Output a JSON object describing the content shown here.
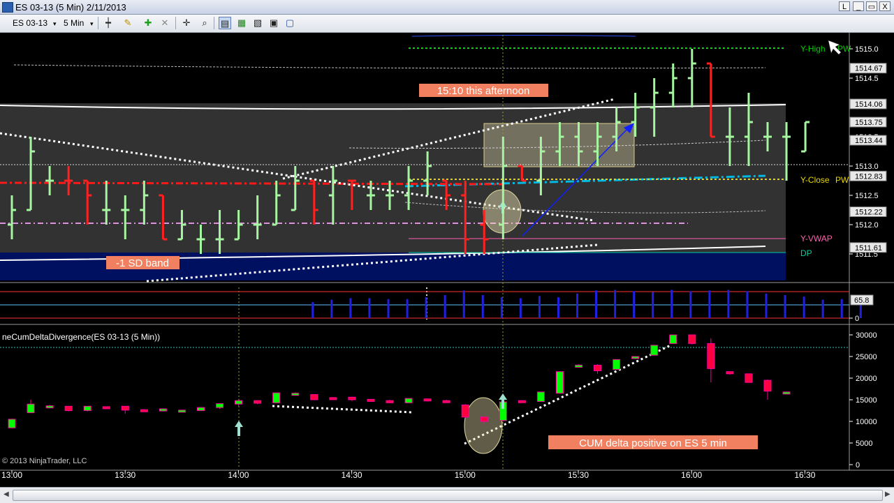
{
  "window": {
    "title": "ES 03-13 (5 Min)  2/11/2013",
    "buttons": [
      "L",
      "_",
      "▭",
      "X"
    ]
  },
  "toolbar": {
    "instrument": "ES 03-13",
    "interval": "5 Min",
    "icons": [
      "bar-type-icon",
      "drawing-pencil-icon",
      "add-indicator-icon",
      "remove-indicator-icon",
      "crosshair-icon",
      "zoom-icon",
      "chart-trader-icon",
      "data-box-icon",
      "properties-icon",
      "alert-icon",
      "window-icon"
    ]
  },
  "colors": {
    "up_bar": "#a6f5a0",
    "down_bar": "#ff2020",
    "prior_high": "#00e000",
    "prior_close": "#e8d800",
    "vwap": "#ff60b0",
    "dp": "#00d0a0",
    "volume": "#2020e0",
    "delta_up": "#00ff00",
    "delta_down": "#ff0040"
  },
  "chart_data": [
    {
      "type": "bar",
      "panel": "price",
      "right_labels": [
        {
          "text": "Y-High",
          "value": 1515.0
        },
        {
          "text": "PW",
          "value": 1515.0
        },
        {
          "text": "Y-Close",
          "value": 1512.86
        },
        {
          "text": "PW",
          "value": 1512.86
        },
        {
          "text": "Y-VWAP",
          "value": 1511.75
        },
        {
          "text": "DP",
          "value": 1511.5
        }
      ],
      "y_ticks": [
        1515.0,
        1514.5,
        1513.5,
        1513.0,
        1512.5,
        1512.0,
        1511.5
      ],
      "price_markers": [
        "1514.67",
        "1514.06",
        "1513.75",
        "1513.44",
        "1512.83",
        "1512.22",
        "1511.61"
      ],
      "ylim": [
        1511.3,
        1515.2
      ],
      "annotations": [
        "15:10 this afternoon",
        "-1 SD band"
      ],
      "x_ticks": [
        "13:00",
        "13:30",
        "14:00",
        "14:30",
        "15:00",
        "15:30",
        "16:00",
        "16:30"
      ],
      "bars": [
        {
          "t": "12:59",
          "o": 1512.0,
          "h": 1512.5,
          "l": 1511.75,
          "c": 1512.25,
          "up": true
        },
        {
          "t": "13:04",
          "o": 1512.25,
          "h": 1513.5,
          "l": 1512.25,
          "c": 1513.25,
          "up": true
        },
        {
          "t": "13:09",
          "o": 1512.75,
          "h": 1513.0,
          "l": 1512.5,
          "c": 1512.75,
          "up": true
        },
        {
          "t": "13:14",
          "o": 1512.75,
          "h": 1513.0,
          "l": 1512.5,
          "c": 1512.75,
          "up": false
        },
        {
          "t": "13:19",
          "o": 1512.75,
          "h": 1512.75,
          "l": 1512.0,
          "c": 1512.5,
          "up": false
        },
        {
          "t": "13:24",
          "o": 1512.25,
          "h": 1512.75,
          "l": 1512.0,
          "c": 1512.25,
          "up": true
        },
        {
          "t": "13:29",
          "o": 1512.25,
          "h": 1512.5,
          "l": 1511.75,
          "c": 1512.25,
          "up": true
        },
        {
          "t": "13:34",
          "o": 1512.25,
          "h": 1512.75,
          "l": 1512.0,
          "c": 1512.5,
          "up": true
        },
        {
          "t": "13:39",
          "o": 1512.5,
          "h": 1512.5,
          "l": 1511.75,
          "c": 1511.75,
          "up": false
        },
        {
          "t": "13:44",
          "o": 1511.75,
          "h": 1512.25,
          "l": 1511.75,
          "c": 1512.0,
          "up": true
        },
        {
          "t": "13:49",
          "o": 1511.75,
          "h": 1512.0,
          "l": 1511.5,
          "c": 1511.75,
          "up": true
        },
        {
          "t": "13:54",
          "o": 1511.75,
          "h": 1512.25,
          "l": 1511.5,
          "c": 1511.75,
          "up": true
        },
        {
          "t": "13:59",
          "o": 1511.75,
          "h": 1512.25,
          "l": 1511.75,
          "c": 1512.0,
          "up": true
        },
        {
          "t": "14:04",
          "o": 1512.0,
          "h": 1512.5,
          "l": 1511.75,
          "c": 1512.0,
          "up": true
        },
        {
          "t": "14:09",
          "o": 1512.0,
          "h": 1512.75,
          "l": 1512.0,
          "c": 1512.5,
          "up": true
        },
        {
          "t": "14:14",
          "o": 1512.25,
          "h": 1513.0,
          "l": 1512.25,
          "c": 1512.75,
          "up": true
        },
        {
          "t": "14:19",
          "o": 1512.75,
          "h": 1512.75,
          "l": 1512.0,
          "c": 1512.25,
          "up": false
        },
        {
          "t": "14:24",
          "o": 1512.5,
          "h": 1513.0,
          "l": 1512.0,
          "c": 1512.75,
          "up": true
        },
        {
          "t": "14:29",
          "o": 1512.75,
          "h": 1512.75,
          "l": 1512.25,
          "c": 1512.75,
          "up": false
        },
        {
          "t": "14:34",
          "o": 1512.5,
          "h": 1512.75,
          "l": 1512.25,
          "c": 1512.5,
          "up": true
        },
        {
          "t": "14:39",
          "o": 1512.5,
          "h": 1512.75,
          "l": 1512.25,
          "c": 1512.5,
          "up": true
        },
        {
          "t": "14:44",
          "o": 1512.5,
          "h": 1513.0,
          "l": 1512.25,
          "c": 1512.75,
          "up": true
        },
        {
          "t": "14:49",
          "o": 1512.75,
          "h": 1513.25,
          "l": 1512.5,
          "c": 1513.0,
          "up": true
        },
        {
          "t": "14:54",
          "o": 1512.75,
          "h": 1512.75,
          "l": 1512.25,
          "c": 1512.5,
          "up": false
        },
        {
          "t": "14:59",
          "o": 1512.5,
          "h": 1512.75,
          "l": 1511.5,
          "c": 1511.75,
          "up": false
        },
        {
          "t": "15:04",
          "o": 1512.0,
          "h": 1512.25,
          "l": 1511.5,
          "c": 1511.75,
          "up": false
        },
        {
          "t": "15:09",
          "o": 1512.0,
          "h": 1513.5,
          "l": 1511.75,
          "c": 1513.0,
          "up": true
        },
        {
          "t": "15:14",
          "o": 1513.0,
          "h": 1513.0,
          "l": 1512.75,
          "c": 1512.75,
          "up": false
        },
        {
          "t": "15:19",
          "o": 1512.75,
          "h": 1513.5,
          "l": 1512.5,
          "c": 1513.25,
          "up": true
        },
        {
          "t": "15:24",
          "o": 1513.25,
          "h": 1513.75,
          "l": 1513.0,
          "c": 1513.5,
          "up": true
        },
        {
          "t": "15:29",
          "o": 1513.5,
          "h": 1513.75,
          "l": 1513.0,
          "c": 1513.25,
          "up": true
        },
        {
          "t": "15:34",
          "o": 1513.25,
          "h": 1513.75,
          "l": 1513.0,
          "c": 1513.5,
          "up": true
        },
        {
          "t": "15:39",
          "o": 1513.5,
          "h": 1514.0,
          "l": 1513.25,
          "c": 1513.75,
          "up": true
        },
        {
          "t": "15:44",
          "o": 1513.75,
          "h": 1514.25,
          "l": 1513.5,
          "c": 1514.0,
          "up": true
        },
        {
          "t": "15:49",
          "o": 1514.0,
          "h": 1514.5,
          "l": 1513.5,
          "c": 1514.25,
          "up": true
        },
        {
          "t": "15:54",
          "o": 1514.25,
          "h": 1514.75,
          "l": 1514.0,
          "c": 1514.5,
          "up": true
        },
        {
          "t": "15:59",
          "o": 1514.5,
          "h": 1515.0,
          "l": 1514.0,
          "c": 1514.75,
          "up": true
        },
        {
          "t": "16:04",
          "o": 1514.75,
          "h": 1514.75,
          "l": 1513.5,
          "c": 1513.5,
          "up": false
        },
        {
          "t": "16:09",
          "o": 1513.5,
          "h": 1514.0,
          "l": 1513.0,
          "c": 1513.5,
          "up": true
        },
        {
          "t": "16:14",
          "o": 1513.5,
          "h": 1514.25,
          "l": 1513.0,
          "c": 1513.75,
          "up": true
        },
        {
          "t": "16:19",
          "o": 1513.5,
          "h": 1513.75,
          "l": 1513.25,
          "c": 1513.5,
          "up": true
        },
        {
          "t": "16:24",
          "o": 1513.5,
          "h": 1513.75,
          "l": 1512.75,
          "c": 1513.5,
          "up": true
        },
        {
          "t": "16:29",
          "o": 1513.25,
          "h": 1513.75,
          "l": 1513.25,
          "c": 1513.75,
          "up": true
        }
      ]
    },
    {
      "type": "bar",
      "panel": "volume",
      "marker": "65.8",
      "y_ticks": [
        0
      ],
      "ylim": [
        0,
        100
      ],
      "values": [
        0,
        0,
        0,
        0,
        0,
        0,
        0,
        0,
        0,
        0,
        0,
        0,
        0,
        0,
        0,
        0,
        52,
        60,
        65,
        65,
        62,
        62,
        68,
        75,
        90,
        75,
        68,
        65,
        72,
        68,
        80,
        90,
        92,
        88,
        85,
        92,
        88,
        90,
        92,
        88,
        80,
        75,
        70,
        60,
        62,
        72
      ]
    },
    {
      "type": "bar",
      "panel": "indicator",
      "title": "neCumDeltaDivergence(ES 03-13 (5 Min))",
      "annotations": [
        "CUM delta positive on ES 5 min"
      ],
      "y_ticks": [
        30000,
        25000,
        20000,
        15000,
        10000,
        5000,
        0
      ],
      "ylim": [
        0,
        32000
      ],
      "candles": [
        {
          "o": 8500,
          "c": 10500,
          "h": 10500,
          "l": 8500
        },
        {
          "o": 12000,
          "c": 14000,
          "h": 15000,
          "l": 12000
        },
        {
          "o": 13200,
          "c": 13600,
          "h": 13800,
          "l": 13000
        },
        {
          "o": 13500,
          "c": 12500,
          "h": 13500,
          "l": 12300
        },
        {
          "o": 12500,
          "c": 13500,
          "h": 13500,
          "l": 12300
        },
        {
          "o": 13400,
          "c": 13100,
          "h": 13400,
          "l": 13000
        },
        {
          "o": 13500,
          "c": 12600,
          "h": 13500,
          "l": 11800
        },
        {
          "o": 12700,
          "c": 12400,
          "h": 12800,
          "l": 12200
        },
        {
          "o": 12400,
          "c": 12900,
          "h": 13000,
          "l": 12300
        },
        {
          "o": 12300,
          "c": 12600,
          "h": 12700,
          "l": 12200
        },
        {
          "o": 12500,
          "c": 13200,
          "h": 13200,
          "l": 12400
        },
        {
          "o": 13200,
          "c": 14100,
          "h": 14100,
          "l": 12900
        },
        {
          "o": 14000,
          "c": 14800,
          "h": 15200,
          "l": 13500
        },
        {
          "o": 14800,
          "c": 14200,
          "h": 14800,
          "l": 14000
        },
        {
          "o": 14300,
          "c": 16600,
          "h": 16600,
          "l": 14300
        },
        {
          "o": 16500,
          "c": 16500,
          "h": 16700,
          "l": 16300
        },
        {
          "o": 16200,
          "c": 15000,
          "h": 16200,
          "l": 15000
        },
        {
          "o": 15500,
          "c": 15200,
          "h": 15600,
          "l": 15000
        },
        {
          "o": 15600,
          "c": 15000,
          "h": 15600,
          "l": 14700
        },
        {
          "o": 15100,
          "c": 14900,
          "h": 15200,
          "l": 14600
        },
        {
          "o": 14800,
          "c": 14300,
          "h": 15000,
          "l": 14200
        },
        {
          "o": 14300,
          "c": 15300,
          "h": 15300,
          "l": 14200
        },
        {
          "o": 15200,
          "c": 14800,
          "h": 15300,
          "l": 14600
        },
        {
          "o": 14800,
          "c": 14500,
          "h": 15000,
          "l": 14300
        },
        {
          "o": 13800,
          "c": 11000,
          "h": 14000,
          "l": 10800
        },
        {
          "o": 11000,
          "c": 10000,
          "h": 11200,
          "l": 9200
        },
        {
          "o": 10200,
          "c": 14500,
          "h": 14500,
          "l": 10000
        },
        {
          "o": 14800,
          "c": 14600,
          "h": 14900,
          "l": 14500
        },
        {
          "o": 14600,
          "c": 16800,
          "h": 16800,
          "l": 14600
        },
        {
          "o": 16500,
          "c": 21500,
          "h": 21500,
          "l": 16500
        },
        {
          "o": 22700,
          "c": 23000,
          "h": 23200,
          "l": 22600
        },
        {
          "o": 23000,
          "c": 21700,
          "h": 23200,
          "l": 21000
        },
        {
          "o": 22000,
          "c": 24300,
          "h": 24300,
          "l": 22000
        },
        {
          "o": 24600,
          "c": 25000,
          "h": 25100,
          "l": 24500
        },
        {
          "o": 25300,
          "c": 27600,
          "h": 27600,
          "l": 25300
        },
        {
          "o": 28000,
          "c": 30000,
          "h": 30000,
          "l": 28000
        },
        {
          "o": 30000,
          "c": 28000,
          "h": 30000,
          "l": 27800
        },
        {
          "o": 28000,
          "c": 22200,
          "h": 29200,
          "l": 19000
        },
        {
          "o": 21500,
          "c": 21000,
          "h": 21500,
          "l": 20800
        },
        {
          "o": 21000,
          "c": 19000,
          "h": 21000,
          "l": 19000
        },
        {
          "o": 19500,
          "c": 17000,
          "h": 19700,
          "l": 15000
        },
        {
          "o": 16800,
          "c": 16800,
          "h": 16900,
          "l": 16700
        }
      ]
    }
  ],
  "copyright": "© 2013 NinjaTrader, LLC"
}
